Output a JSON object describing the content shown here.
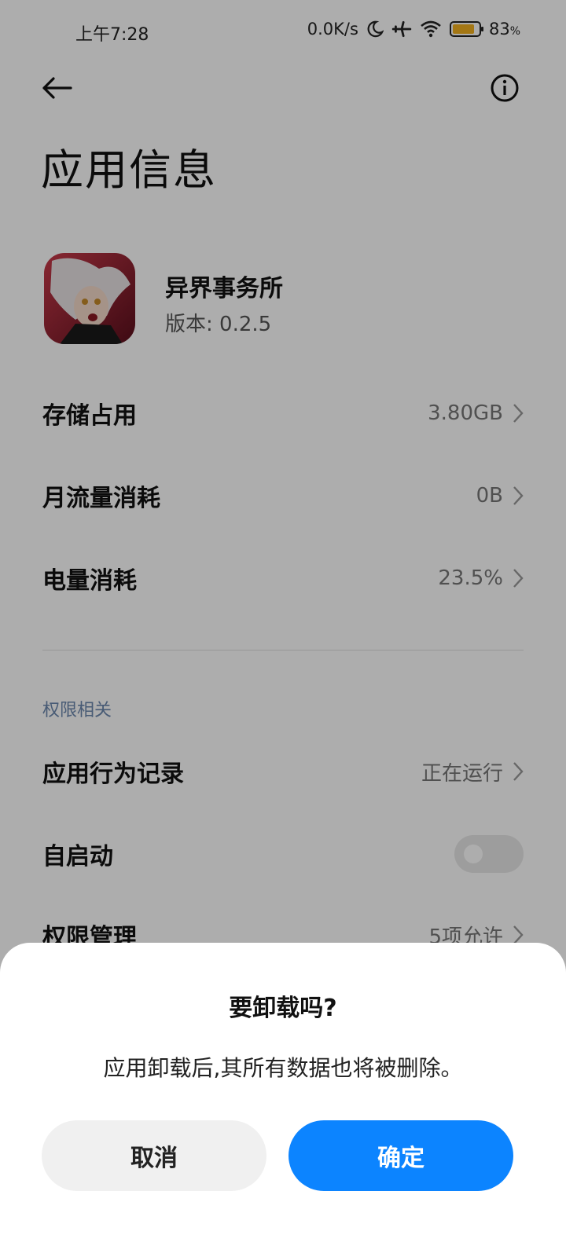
{
  "status_bar": {
    "time": "上午7:28",
    "net_speed": "0.0K/s",
    "battery_percent": "83",
    "battery_pct_sign": "%",
    "battery_level": 0.83,
    "icons": [
      "moon-icon",
      "airplane-icon",
      "wifi-icon",
      "battery-icon"
    ]
  },
  "header": {
    "title": "应用信息",
    "back_icon": "arrow-left-icon",
    "info_icon": "info-circle-icon"
  },
  "app": {
    "name": "异界事务所",
    "version": "版本: 0.2.5"
  },
  "usage": [
    {
      "label": "存储占用",
      "value": "3.80GB"
    },
    {
      "label": "月流量消耗",
      "value": "0B"
    },
    {
      "label": "电量消耗",
      "value": "23.5%"
    }
  ],
  "permissions": {
    "section_label": "权限相关",
    "behavior": {
      "label": "应用行为记录",
      "value": "正在运行"
    },
    "autostart": {
      "label": "自启动",
      "enabled": false
    },
    "manage": {
      "label": "权限管理",
      "value": "5项允许"
    }
  },
  "dialog": {
    "title": "要卸载吗?",
    "message": "应用卸载后,其所有数据也将被删除。",
    "cancel_label": "取消",
    "confirm_label": "确定"
  },
  "colors": {
    "accent": "#0c84ff",
    "battery": "#f2b01e",
    "section_label": "#6b86ad"
  }
}
